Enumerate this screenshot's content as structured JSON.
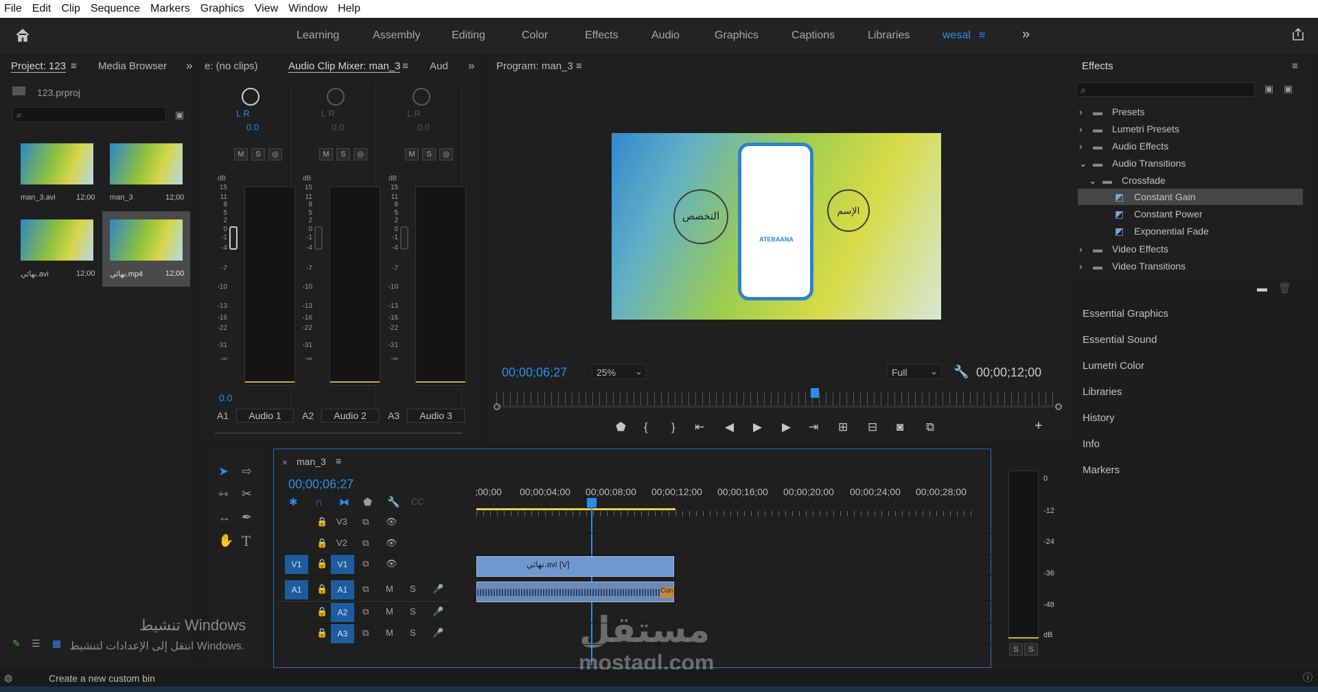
{
  "menu": [
    "File",
    "Edit",
    "Clip",
    "Sequence",
    "Markers",
    "Graphics",
    "View",
    "Window",
    "Help"
  ],
  "workspaces": {
    "items": [
      "Learning",
      "Assembly",
      "Editing",
      "Color",
      "Effects",
      "Audio",
      "Graphics",
      "Captions",
      "Libraries"
    ],
    "active": "wesal",
    "more": "»"
  },
  "project": {
    "tab_project": "Project: 123",
    "tab_media": "Media Browser",
    "file": "123.prproj",
    "items": [
      {
        "name": "man_3.avi",
        "dur": "12;00"
      },
      {
        "name": "man_3",
        "dur": "12;00"
      },
      {
        "name": "نهائي.avi",
        "dur": "12;00"
      },
      {
        "name": "نهائي.mp4",
        "dur": "12;00"
      }
    ]
  },
  "source_tab": "e: (no clips)",
  "mixer": {
    "tab": "Audio Clip Mixer: man_3",
    "tab2": "Aud",
    "lr": "L R",
    "db_unit": "dB",
    "pan": "0.0",
    "master_val": "0.0",
    "btn_m": "M",
    "btn_s": "S",
    "scale": [
      "15",
      "11",
      "8",
      "5",
      "2",
      "0",
      "-1",
      "-4",
      "-7",
      "-10",
      "-13",
      "-16",
      "-22",
      "-31",
      "-∞"
    ],
    "tracks": [
      {
        "id": "A1",
        "name": "Audio 1"
      },
      {
        "id": "A2",
        "name": "Audio 2"
      },
      {
        "id": "A3",
        "name": "Audio 3"
      }
    ]
  },
  "program": {
    "title": "Program: man_3",
    "timecode": "00;00;06;27",
    "zoom": "25%",
    "quality": "Full",
    "duration": "00;00;12;00",
    "frame_text": {
      "left": "التخصص",
      "right": "الإسم",
      "logo": "ATEBAANA"
    }
  },
  "effects": {
    "title": "Effects",
    "tree": [
      {
        "label": "Presets",
        "type": "folder-star",
        "level": 0,
        "expanded": false
      },
      {
        "label": "Lumetri Presets",
        "type": "folder-star",
        "level": 0,
        "expanded": false
      },
      {
        "label": "Audio Effects",
        "type": "folder",
        "level": 0,
        "expanded": false
      },
      {
        "label": "Audio Transitions",
        "type": "folder",
        "level": 0,
        "expanded": true
      },
      {
        "label": "Crossfade",
        "type": "folder",
        "level": 1,
        "expanded": true
      },
      {
        "label": "Constant Gain",
        "type": "effect",
        "level": 2,
        "selected": true
      },
      {
        "label": "Constant Power",
        "type": "effect",
        "level": 2
      },
      {
        "label": "Exponential Fade",
        "type": "effect",
        "level": 2
      },
      {
        "label": "Video Effects",
        "type": "folder",
        "level": 0,
        "expanded": false
      },
      {
        "label": "Video Transitions",
        "type": "folder",
        "level": 0,
        "expanded": false
      }
    ],
    "panels": [
      "Essential Graphics",
      "Essential Sound",
      "Lumetri Color",
      "Libraries",
      "History",
      "Info",
      "Markers"
    ]
  },
  "timeline": {
    "tab": "man_3",
    "timecode": "00;00;06;27",
    "ruler": [
      ";00;00",
      "00;00;04;00",
      "00;00;08;00",
      "00;00;12;00",
      "00;00;16;00",
      "00;00;20;00",
      "00;00;24;00",
      "00;00;28;00"
    ],
    "tracks": [
      {
        "src": "",
        "id": "V3",
        "kind": "video"
      },
      {
        "src": "",
        "id": "V2",
        "kind": "video"
      },
      {
        "src": "V1",
        "id": "V1",
        "kind": "video"
      },
      {
        "src": "A1",
        "id": "A1",
        "kind": "audio"
      },
      {
        "src": "",
        "id": "A2",
        "kind": "audio"
      },
      {
        "src": "",
        "id": "A3",
        "kind": "audio"
      }
    ],
    "btn_m": "M",
    "btn_s": "S",
    "video_clip": "نهائي.avi [V]",
    "audio_clip_tail": "Con",
    "meter_scale": [
      "0",
      "-12",
      "-24",
      "-36",
      "-48",
      "dB"
    ],
    "meter_buttons": [
      "S",
      "S"
    ]
  },
  "overlays": {
    "activate_title": "تنشيط Windows",
    "activate_sub": "انتقل إلى الإعدادات لتنشيط Windows.",
    "watermark_ar": "مستقل",
    "watermark_en": "mostaql.com"
  },
  "status": "Create a new custom bin",
  "colors": {
    "accent": "#2d8ceb",
    "clip_video": "#6f98cf",
    "clip_audio": "#6a88b8",
    "track_badge": "#1d5c9e"
  }
}
